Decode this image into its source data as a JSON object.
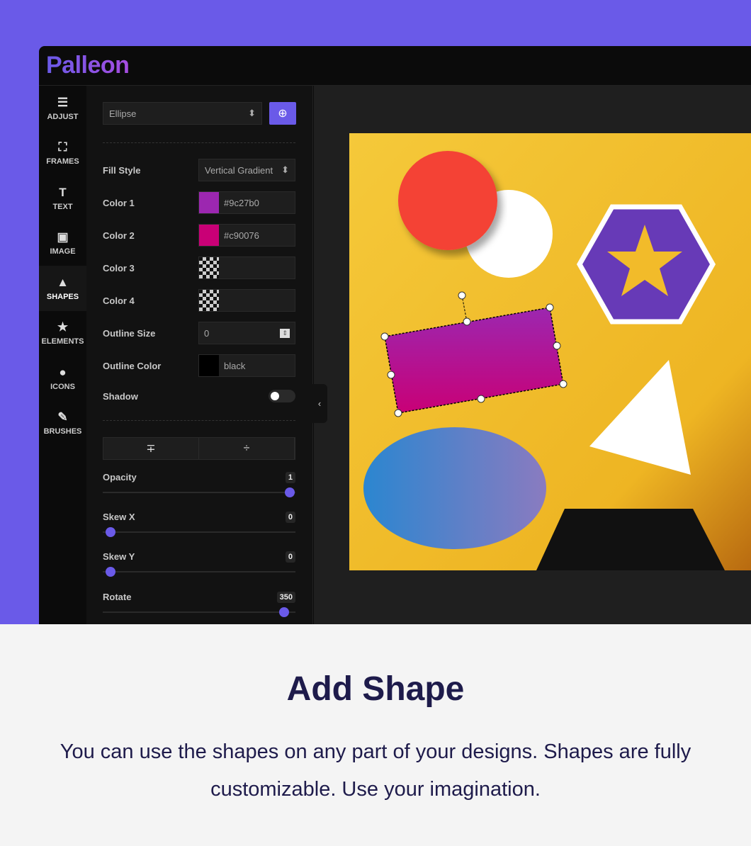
{
  "app": {
    "logo": "Palleon"
  },
  "sidebar": {
    "items": [
      {
        "label": "ADJUST",
        "icon": "sliders-icon"
      },
      {
        "label": "FRAMES",
        "icon": "frame-icon"
      },
      {
        "label": "TEXT",
        "icon": "text-icon"
      },
      {
        "label": "IMAGE",
        "icon": "image-add-icon"
      },
      {
        "label": "SHAPES",
        "icon": "shapes-icon",
        "active": true
      },
      {
        "label": "ELEMENTS",
        "icon": "star-icon"
      },
      {
        "label": "ICONS",
        "icon": "map-pin-icon"
      },
      {
        "label": "BRUSHES",
        "icon": "brush-icon"
      }
    ]
  },
  "panel": {
    "shape_select": "Ellipse",
    "fill_style": {
      "label": "Fill Style",
      "value": "Vertical Gradient"
    },
    "color1": {
      "label": "Color 1",
      "value": "#9c27b0"
    },
    "color2": {
      "label": "Color 2",
      "value": "#c90076"
    },
    "color3": {
      "label": "Color 3",
      "value": ""
    },
    "color4": {
      "label": "Color 4",
      "value": ""
    },
    "outline_size": {
      "label": "Outline Size",
      "value": "0"
    },
    "outline_color": {
      "label": "Outline Color",
      "value": "black"
    },
    "shadow": {
      "label": "Shadow",
      "on": false
    },
    "opacity": {
      "label": "Opacity",
      "value": "1",
      "fraction": 1
    },
    "skew_x": {
      "label": "Skew X",
      "value": "0",
      "fraction": 0
    },
    "skew_y": {
      "label": "Skew Y",
      "value": "0",
      "fraction": 0
    },
    "rotate": {
      "label": "Rotate",
      "value": "350",
      "fraction": 0.97
    }
  },
  "colors": {
    "accent": "#6a5ae8",
    "canvas": "#f2bb2a"
  },
  "caption": {
    "title": "Add Shape",
    "description": "You can use the shapes on any part of your designs. Shapes are fully customizable. Use your imagination."
  }
}
